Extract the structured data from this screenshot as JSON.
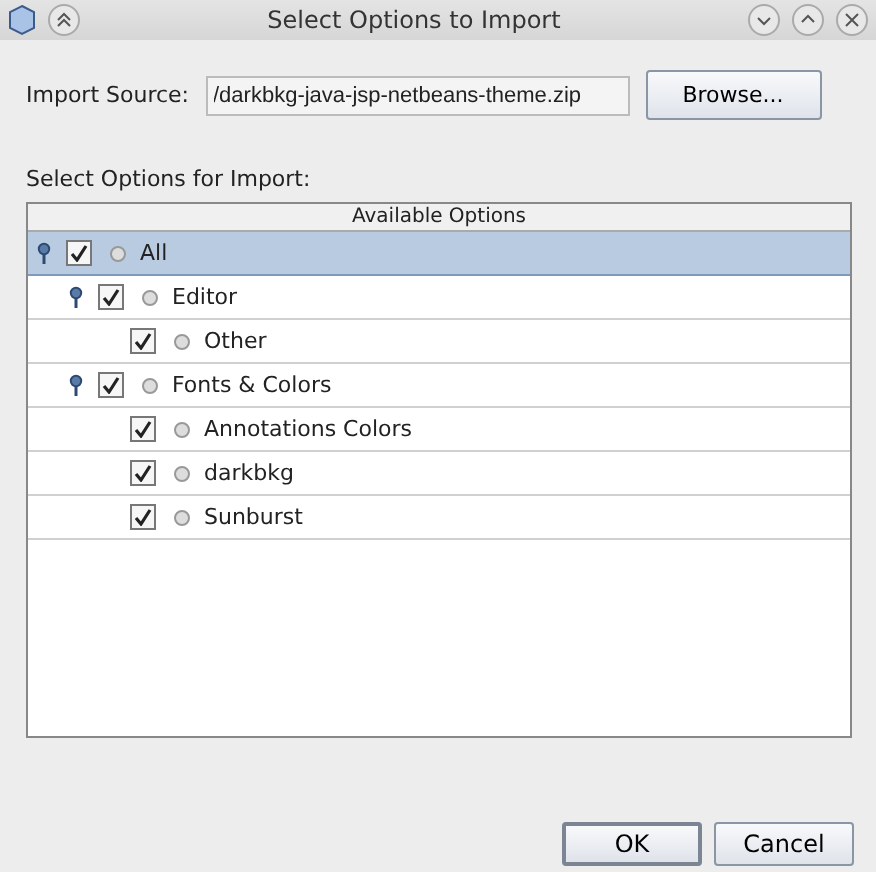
{
  "window": {
    "title": "Select Options to Import"
  },
  "import_source": {
    "label": "Import Source:",
    "value": "/darkbkg-java-jsp-netbeans-theme.zip",
    "browse_button": "Browse..."
  },
  "options_label": "Select Options for Import:",
  "table": {
    "columns": [
      "Available Options"
    ],
    "tree": [
      {
        "label": "All",
        "checked": true,
        "expanded": true,
        "selected": true,
        "children": [
          {
            "label": "Editor",
            "checked": true,
            "expanded": true,
            "selected": false,
            "children": [
              {
                "label": "Other",
                "checked": true,
                "selected": false
              }
            ]
          },
          {
            "label": "Fonts & Colors",
            "checked": true,
            "expanded": true,
            "selected": false,
            "children": [
              {
                "label": "Annotations Colors",
                "checked": true,
                "selected": false
              },
              {
                "label": "darkbkg",
                "checked": true,
                "selected": false
              },
              {
                "label": "Sunburst",
                "checked": true,
                "selected": false
              }
            ]
          }
        ]
      }
    ]
  },
  "buttons": [
    "OK",
    "Cancel"
  ]
}
